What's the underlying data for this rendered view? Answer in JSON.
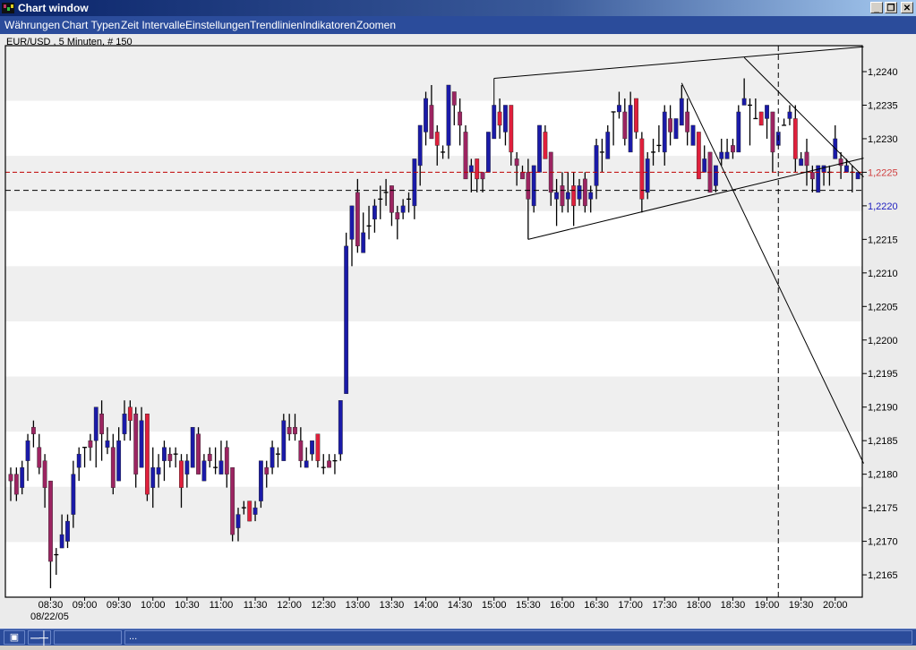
{
  "window": {
    "title": "Chart window",
    "minimize": "_",
    "restore": "❐",
    "close": "✕"
  },
  "menu": [
    "Währungen",
    "Chart Typen",
    "Zeit Intervalle",
    "Einstellungen",
    "Trendlinien",
    "Indikatoren",
    "Zoomen"
  ],
  "caption": "EUR/USD , 5 Minuten, # 150",
  "statusbar": {
    "pin_icon": "pin-icon",
    "crosshair_icon": "crosshair-icon",
    "field1": "",
    "field2": "..."
  },
  "colors": {
    "bull": "#1a1aa8",
    "bear": "#9c2461",
    "bear_strong": "#e0203c",
    "ref_line": "#c00000",
    "ref_label": "#d04040",
    "current_label": "#2020c0"
  },
  "chart_data": {
    "type": "candlestick",
    "symbol": "EUR/USD",
    "interval": "5 Minuten",
    "count": 150,
    "date_label": "08/22/05",
    "first_candle_time": "07:55",
    "ylim": [
      1.21605,
      1.22455
    ],
    "y_ticks": [
      "1,2240",
      "1,2235",
      "1,2230",
      "1,2225",
      "1,2220",
      "1,2215",
      "1,2210",
      "1,2205",
      "1,2200",
      "1,2195",
      "1,2190",
      "1,2185",
      "1,2180",
      "1,2175",
      "1,2170",
      "1,2165"
    ],
    "y_tick_values": [
      1.224,
      1.2235,
      1.223,
      1.2225,
      1.222,
      1.2215,
      1.221,
      1.2205,
      1.22,
      1.2195,
      1.219,
      1.2185,
      1.218,
      1.2175,
      1.217,
      1.2165
    ],
    "x_ticks": [
      "08:30",
      "09:00",
      "09:30",
      "10:00",
      "10:30",
      "11:00",
      "11:30",
      "12:00",
      "12:30",
      "13:00",
      "13:30",
      "14:00",
      "14:30",
      "15:00",
      "15:30",
      "16:00",
      "16:30",
      "17:00",
      "17:30",
      "18:00",
      "18:30",
      "19:00",
      "19:30",
      "20:00"
    ],
    "x_tick_first_index": 7,
    "x_tick_step": 6,
    "reference_price": 1.2225,
    "current_price": 1.22223,
    "cursor_candle_index": 135,
    "red_candles": [
      21,
      24,
      30,
      42,
      54,
      75,
      82,
      86,
      88,
      94,
      99,
      110,
      111,
      121,
      132,
      138
    ],
    "trendlines": [
      {
        "name": "upper-channel",
        "points": [
          [
            85,
            1.2239
          ],
          [
            150,
            1.22437
          ]
        ]
      },
      {
        "name": "upper-anchor",
        "points": [
          [
            85,
            1.2239
          ],
          [
            85,
            1.2235
          ]
        ]
      },
      {
        "name": "lower-channel",
        "points": [
          [
            91,
            1.2215
          ],
          [
            150,
            1.22271
          ]
        ]
      },
      {
        "name": "steep-downtrend",
        "points": [
          [
            118,
            1.22383
          ],
          [
            150,
            1.21816
          ]
        ]
      },
      {
        "name": "short-downtrend",
        "points": [
          [
            129,
            1.22421
          ],
          [
            150,
            1.22243
          ]
        ]
      }
    ],
    "ohlc": [
      [
        1.218,
        1.2181,
        1.2176,
        1.2179
      ],
      [
        1.218,
        1.2181,
        1.2176,
        1.2177
      ],
      [
        1.2178,
        1.2182,
        1.2177,
        1.2181
      ],
      [
        1.2182,
        1.2186,
        1.2179,
        1.2185
      ],
      [
        1.2187,
        1.2188,
        1.2184,
        1.2186
      ],
      [
        1.2184,
        1.2186,
        1.218,
        1.2181
      ],
      [
        1.2182,
        1.2183,
        1.2175,
        1.2178
      ],
      [
        1.2179,
        1.2179,
        1.2163,
        1.2167
      ],
      [
        1.2168,
        1.2169,
        1.2165,
        1.2168
      ],
      [
        1.2169,
        1.2174,
        1.2169,
        1.2171
      ],
      [
        1.217,
        1.2174,
        1.2169,
        1.2173
      ],
      [
        1.2174,
        1.2182,
        1.2172,
        1.218
      ],
      [
        1.2181,
        1.2184,
        1.2179,
        1.2183
      ],
      [
        1.2184,
        1.2184,
        1.2181,
        1.2184
      ],
      [
        1.2185,
        1.2186,
        1.2182,
        1.2184
      ],
      [
        1.2185,
        1.219,
        1.2181,
        1.219
      ],
      [
        1.2189,
        1.2191,
        1.2182,
        1.2186
      ],
      [
        1.2184,
        1.2187,
        1.2183,
        1.2185
      ],
      [
        1.2184,
        1.2186,
        1.2177,
        1.2178
      ],
      [
        1.2179,
        1.2187,
        1.2179,
        1.2185
      ],
      [
        1.2186,
        1.2191,
        1.2185,
        1.2189
      ],
      [
        1.219,
        1.2191,
        1.2185,
        1.2188
      ],
      [
        1.2189,
        1.219,
        1.2178,
        1.218
      ],
      [
        1.2181,
        1.219,
        1.2181,
        1.2188
      ],
      [
        1.2189,
        1.2189,
        1.2176,
        1.2177
      ],
      [
        1.2178,
        1.2184,
        1.2175,
        1.2181
      ],
      [
        1.218,
        1.2183,
        1.2178,
        1.2181
      ],
      [
        1.2182,
        1.2185,
        1.2179,
        1.2184
      ],
      [
        1.2183,
        1.2184,
        1.2181,
        1.2182
      ],
      [
        1.2183,
        1.2184,
        1.2181,
        1.2183
      ],
      [
        1.2182,
        1.2183,
        1.2175,
        1.2178
      ],
      [
        1.218,
        1.2183,
        1.2178,
        1.2182
      ],
      [
        1.2181,
        1.2187,
        1.2181,
        1.2187
      ],
      [
        1.2186,
        1.2187,
        1.218,
        1.218
      ],
      [
        1.2179,
        1.2183,
        1.2179,
        1.2182
      ],
      [
        1.2183,
        1.2184,
        1.2181,
        1.2182
      ],
      [
        1.2181,
        1.2184,
        1.218,
        1.2181
      ],
      [
        1.218,
        1.2185,
        1.218,
        1.2182
      ],
      [
        1.2184,
        1.2185,
        1.2178,
        1.218
      ],
      [
        1.2181,
        1.2181,
        1.217,
        1.2171
      ],
      [
        1.2172,
        1.2175,
        1.217,
        1.2174
      ],
      [
        1.2175,
        1.2176,
        1.2174,
        1.2175
      ],
      [
        1.2176,
        1.2176,
        1.2173,
        1.2173
      ],
      [
        1.2174,
        1.2176,
        1.2173,
        1.2175
      ],
      [
        1.2176,
        1.2182,
        1.2175,
        1.2182
      ],
      [
        1.2181,
        1.2182,
        1.2178,
        1.218
      ],
      [
        1.2181,
        1.2185,
        1.218,
        1.2184
      ],
      [
        1.2183,
        1.2184,
        1.2181,
        1.2183
      ],
      [
        1.2182,
        1.2189,
        1.2182,
        1.2188
      ],
      [
        1.2187,
        1.2189,
        1.2185,
        1.2186
      ],
      [
        1.2187,
        1.2189,
        1.2185,
        1.2186
      ],
      [
        1.2185,
        1.2187,
        1.2181,
        1.2182
      ],
      [
        1.2181,
        1.2184,
        1.2181,
        1.2182
      ],
      [
        1.2183,
        1.2185,
        1.2182,
        1.2185
      ],
      [
        1.2186,
        1.2186,
        1.2181,
        1.2182
      ],
      [
        1.2181,
        1.2183,
        1.218,
        1.2181
      ],
      [
        1.2182,
        1.2183,
        1.2181,
        1.2181
      ],
      [
        1.2182,
        1.2183,
        1.218,
        1.2182
      ],
      [
        1.2183,
        1.2191,
        1.2182,
        1.2191
      ],
      [
        1.2192,
        1.2216,
        1.2192,
        1.2214
      ],
      [
        1.2215,
        1.222,
        1.2211,
        1.222
      ],
      [
        1.2222,
        1.2224,
        1.2213,
        1.2214
      ],
      [
        1.2213,
        1.2219,
        1.2213,
        1.2216
      ],
      [
        1.2217,
        1.222,
        1.2215,
        1.2217
      ],
      [
        1.2218,
        1.2221,
        1.2216,
        1.222
      ],
      [
        1.2221,
        1.2223,
        1.2218,
        1.2221
      ],
      [
        1.2222,
        1.2224,
        1.222,
        1.2222
      ],
      [
        1.2223,
        1.2223,
        1.2217,
        1.2219
      ],
      [
        1.2219,
        1.222,
        1.2215,
        1.2218
      ],
      [
        1.2219,
        1.2221,
        1.2218,
        1.222
      ],
      [
        1.2221,
        1.2222,
        1.2219,
        1.2221
      ],
      [
        1.222,
        1.2227,
        1.2218,
        1.2227
      ],
      [
        1.2226,
        1.2232,
        1.2223,
        1.2232
      ],
      [
        1.2231,
        1.2237,
        1.2229,
        1.2236
      ],
      [
        1.2235,
        1.2238,
        1.223,
        1.223
      ],
      [
        1.2231,
        1.2232,
        1.2226,
        1.2229
      ],
      [
        1.2228,
        1.2229,
        1.2227,
        1.2228
      ],
      [
        1.2229,
        1.2238,
        1.2227,
        1.2238
      ],
      [
        1.2237,
        1.2237,
        1.2232,
        1.2235
      ],
      [
        1.2234,
        1.2236,
        1.2229,
        1.2232
      ],
      [
        1.2231,
        1.2232,
        1.2224,
        1.2224
      ],
      [
        1.2225,
        1.2227,
        1.2222,
        1.2226
      ],
      [
        1.2227,
        1.2227,
        1.2222,
        1.2224
      ],
      [
        1.2225,
        1.2225,
        1.2222,
        1.2224
      ],
      [
        1.2225,
        1.2231,
        1.2225,
        1.2231
      ],
      [
        1.223,
        1.2235,
        1.223,
        1.2235
      ],
      [
        1.2234,
        1.2236,
        1.223,
        1.2232
      ],
      [
        1.2231,
        1.2235,
        1.2229,
        1.2235
      ],
      [
        1.2235,
        1.2235,
        1.2226,
        1.2228
      ],
      [
        1.2227,
        1.2228,
        1.2223,
        1.2226
      ],
      [
        1.2225,
        1.2226,
        1.2224,
        1.2224
      ],
      [
        1.2225,
        1.2227,
        1.2215,
        1.2221
      ],
      [
        1.222,
        1.2226,
        1.2219,
        1.2226
      ],
      [
        1.2225,
        1.2232,
        1.2225,
        1.2232
      ],
      [
        1.2231,
        1.2232,
        1.2227,
        1.2227
      ],
      [
        1.2228,
        1.2228,
        1.222,
        1.2222
      ],
      [
        1.2221,
        1.2224,
        1.2217,
        1.2222
      ],
      [
        1.2223,
        1.2225,
        1.2219,
        1.222
      ],
      [
        1.2221,
        1.2225,
        1.2219,
        1.2222
      ],
      [
        1.2223,
        1.2225,
        1.2217,
        1.222
      ],
      [
        1.2221,
        1.2224,
        1.222,
        1.2223
      ],
      [
        1.2224,
        1.2225,
        1.2219,
        1.222
      ],
      [
        1.2221,
        1.2223,
        1.2219,
        1.2222
      ],
      [
        1.2223,
        1.223,
        1.2221,
        1.2229
      ],
      [
        1.2228,
        1.223,
        1.2225,
        1.2228
      ],
      [
        1.2227,
        1.2232,
        1.2227,
        1.2231
      ],
      [
        1.2234,
        1.2234,
        1.2229,
        1.2234
      ],
      [
        1.2234,
        1.2237,
        1.2233,
        1.2235
      ],
      [
        1.2234,
        1.2236,
        1.2229,
        1.223
      ],
      [
        1.2228,
        1.2237,
        1.2228,
        1.2235
      ],
      [
        1.2236,
        1.2236,
        1.223,
        1.2231
      ],
      [
        1.223,
        1.2231,
        1.2219,
        1.2221
      ],
      [
        1.2222,
        1.2228,
        1.2221,
        1.2227
      ],
      [
        1.2228,
        1.223,
        1.2226,
        1.2228
      ],
      [
        1.2229,
        1.2232,
        1.2228,
        1.2229
      ],
      [
        1.2228,
        1.2235,
        1.2226,
        1.2234
      ],
      [
        1.2233,
        1.2235,
        1.2229,
        1.2231
      ],
      [
        1.223,
        1.2233,
        1.223,
        1.2233
      ],
      [
        1.2232,
        1.2238,
        1.2232,
        1.2236
      ],
      [
        1.2234,
        1.2236,
        1.2229,
        1.2231
      ],
      [
        1.2229,
        1.2232,
        1.2229,
        1.2232
      ],
      [
        1.2231,
        1.2231,
        1.2224,
        1.2224
      ],
      [
        1.2225,
        1.2229,
        1.2225,
        1.2227
      ],
      [
        1.2228,
        1.2228,
        1.2222,
        1.2222
      ],
      [
        1.2223,
        1.2226,
        1.2222,
        1.2226
      ],
      [
        1.2227,
        1.223,
        1.2226,
        1.2228
      ],
      [
        1.2227,
        1.223,
        1.2227,
        1.2228
      ],
      [
        1.2229,
        1.223,
        1.2227,
        1.2228
      ],
      [
        1.2228,
        1.2235,
        1.2228,
        1.2234
      ],
      [
        1.2235,
        1.2239,
        1.2235,
        1.2236
      ],
      [
        1.2235,
        1.2236,
        1.2229,
        1.2235
      ],
      [
        1.2233,
        1.2236,
        1.2233,
        1.2233
      ],
      [
        1.2234,
        1.2234,
        1.2232,
        1.2232
      ],
      [
        1.2233,
        1.2235,
        1.223,
        1.2235
      ],
      [
        1.2234,
        1.2234,
        1.2225,
        1.2228
      ],
      [
        1.2229,
        1.2231,
        1.2229,
        1.2231
      ],
      [
        1.2232,
        1.2233,
        1.2232,
        1.2232
      ],
      [
        1.2233,
        1.2235,
        1.2232,
        1.2234
      ],
      [
        1.2233,
        1.2235,
        1.2225,
        1.2227
      ],
      [
        1.2226,
        1.2228,
        1.2226,
        1.2227
      ],
      [
        1.2228,
        1.223,
        1.2223,
        1.2226
      ],
      [
        1.2225,
        1.2226,
        1.2222,
        1.2224
      ],
      [
        1.2222,
        1.2226,
        1.2222,
        1.2226
      ],
      [
        1.2225,
        1.2226,
        1.2223,
        1.2226
      ],
      [
        1.2225,
        1.2226,
        1.2223,
        1.2225
      ],
      [
        1.2227,
        1.2232,
        1.2227,
        1.223
      ],
      [
        1.2227,
        1.2228,
        1.2224,
        1.2226
      ],
      [
        1.2225,
        1.2227,
        1.2225,
        1.2226
      ],
      [
        1.2225,
        1.2226,
        1.2222,
        1.2225
      ],
      [
        1.2224,
        1.2225,
        1.2224,
        1.2225
      ]
    ]
  }
}
